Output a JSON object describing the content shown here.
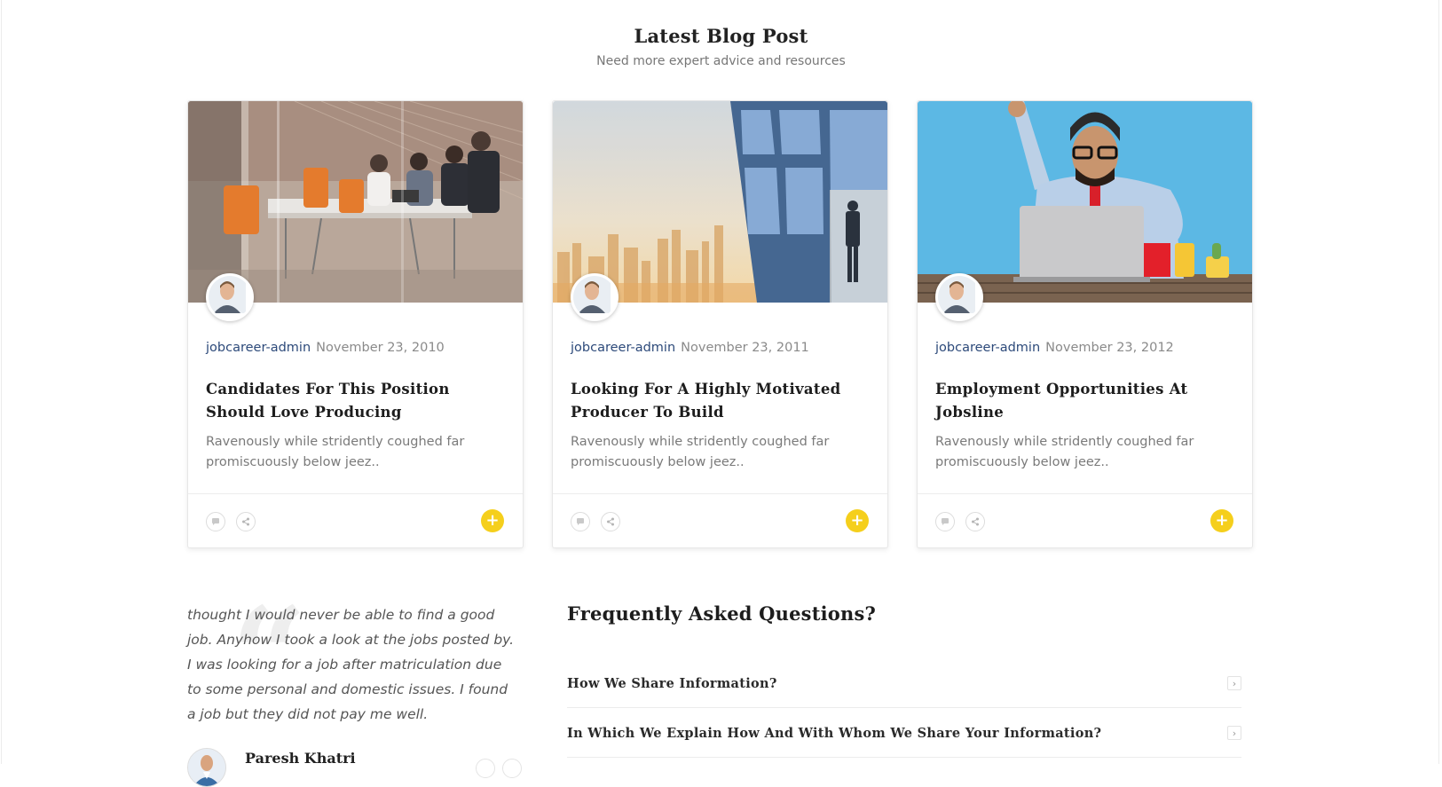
{
  "section": {
    "title": "Latest Blog Post",
    "subtitle": "Need more expert advice and resources"
  },
  "posts": [
    {
      "author": "jobcareer-admin",
      "date": "November 23, 2010",
      "title": "Candidates For This Position Should Love Producing",
      "excerpt": "Ravenously while stridently coughed far promiscuously below jeez..",
      "image": "office-meeting-photo"
    },
    {
      "author": "jobcareer-admin",
      "date": "November 23, 2011",
      "title": "Looking For A Highly Motivated Producer To Build",
      "excerpt": "Ravenously while stridently coughed far promiscuously below jeez..",
      "image": "city-skyline-window-photo"
    },
    {
      "author": "jobcareer-admin",
      "date": "November 23, 2012",
      "title": "Employment Opportunities At Jobsline",
      "excerpt": "Ravenously while stridently coughed far promiscuously below jeez..",
      "image": "man-with-laptop-photo"
    }
  ],
  "icons": {
    "comment": "comment-icon",
    "share": "share-icon",
    "plus": "plus-icon",
    "chevron": "chevron-right-icon",
    "quote": "quote-icon"
  },
  "testimonial": {
    "text": "thought I would never be able to find a good job. Anyhow I took a look at the jobs posted by. I was looking for a job after matriculation due to some personal and domestic issues. I found a job but they did not pay me well.",
    "name": "Paresh Khatri"
  },
  "faq": {
    "title": "Frequently Asked Questions?",
    "items": [
      {
        "question": "How We Share Information?"
      },
      {
        "question": "In Which We Explain How And With Whom We Share Your Information?"
      }
    ]
  },
  "colors": {
    "accent_yellow": "#f5cf1c",
    "author_link": "#2d4a7a"
  }
}
